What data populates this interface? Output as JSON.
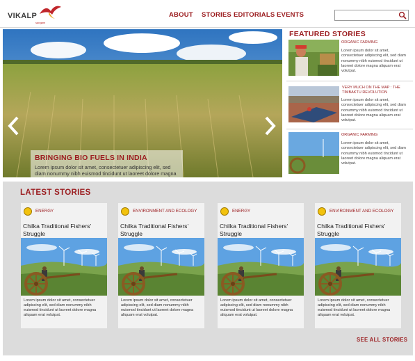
{
  "brand": {
    "name": "VIKALP",
    "tagline": "sangam"
  },
  "nav": {
    "about": "ABOUT",
    "stories": "STORIES",
    "editorials": "EDITORIALS",
    "events": "EVENTS"
  },
  "search": {
    "placeholder": "",
    "icon": "search-icon"
  },
  "hero": {
    "title": "BRINGING BIO FUELS IN INDIA",
    "text": "Lorem ipsum dolor sit amet, consectetuer adipiscing elit, sed diam nonummy nibh euismod tincidunt ut laoreet dolore magna aliquam erat volutpat.",
    "prev_icon": "chevron-left-icon",
    "next_icon": "chevron-right-icon"
  },
  "featured": {
    "title": "FEATURED STORIES",
    "items": [
      {
        "category": "ORGANIC FARMING",
        "text": "Lorem ipsum dolor sit amet, consectetuer adipiscing elit, sed diam nonummy nibh euismod tincidunt ut laoreet dolore magna aliquam erat volutpat."
      },
      {
        "category": "VERY MUCH ON THE MAP : THE TIMBAKTU REVOLUTION",
        "text": "Lorem ipsum dolor sit amet, consectetuer adipiscing elit, sed diam nonummy nibh euismod tincidunt ut laoreet dolore magna aliquam erat volutpat."
      },
      {
        "category": "ORGANIC FARMING",
        "text": "Lorem ipsum dolor sit amet, consectetuer adipiscing elit, sed diam nonummy nibh euismod tincidunt ut laoreet dolore magna aliquam erat volutpat."
      }
    ]
  },
  "latest": {
    "title": "LATEST STORIES",
    "see_all": "SEE ALL STORIES",
    "cards": [
      {
        "category": "ENERGY",
        "title": "Chilka Traditional Fishers' Struggle",
        "text": "Lorem ipsum dolor sit amet, consectetuer adipiscing elit, sed diam nonummy nibh euismod tincidunt ut laoreet dolore magna aliquam erat volutpat."
      },
      {
        "category": "ENVIRONMENT AND ECOLOGY",
        "title": "Chilka Traditional Fishers' Struggle",
        "text": "Lorem ipsum dolor sit amet, consectetuer adipiscing elit, sed diam nonummy nibh euismod tincidunt ut laoreet dolore magna aliquam erat volutpat."
      },
      {
        "category": "ENERGY",
        "title": "Chilka Traditional Fishers' Struggle",
        "text": "Lorem ipsum dolor sit amet, consectetuer adipiscing elit, sed diam nonummy nibh euismod tincidunt ut laoreet dolore magna aliquam erat volutpat."
      },
      {
        "category": "ENVIRONMENT AND ECOLOGY",
        "title": "Chilka Traditional Fishers' Struggle",
        "text": "Lorem ipsum dolor sit amet, consectetuer adipiscing elit, sed diam nonummy nibh euismod tincidunt ut laoreet dolore magna aliquam erat volutpat."
      }
    ]
  },
  "colors": {
    "accent": "#9b1c1f",
    "badge": "#f2c20d",
    "section_bg": "#dcdcdc",
    "card_bg": "#f2f2f2"
  }
}
